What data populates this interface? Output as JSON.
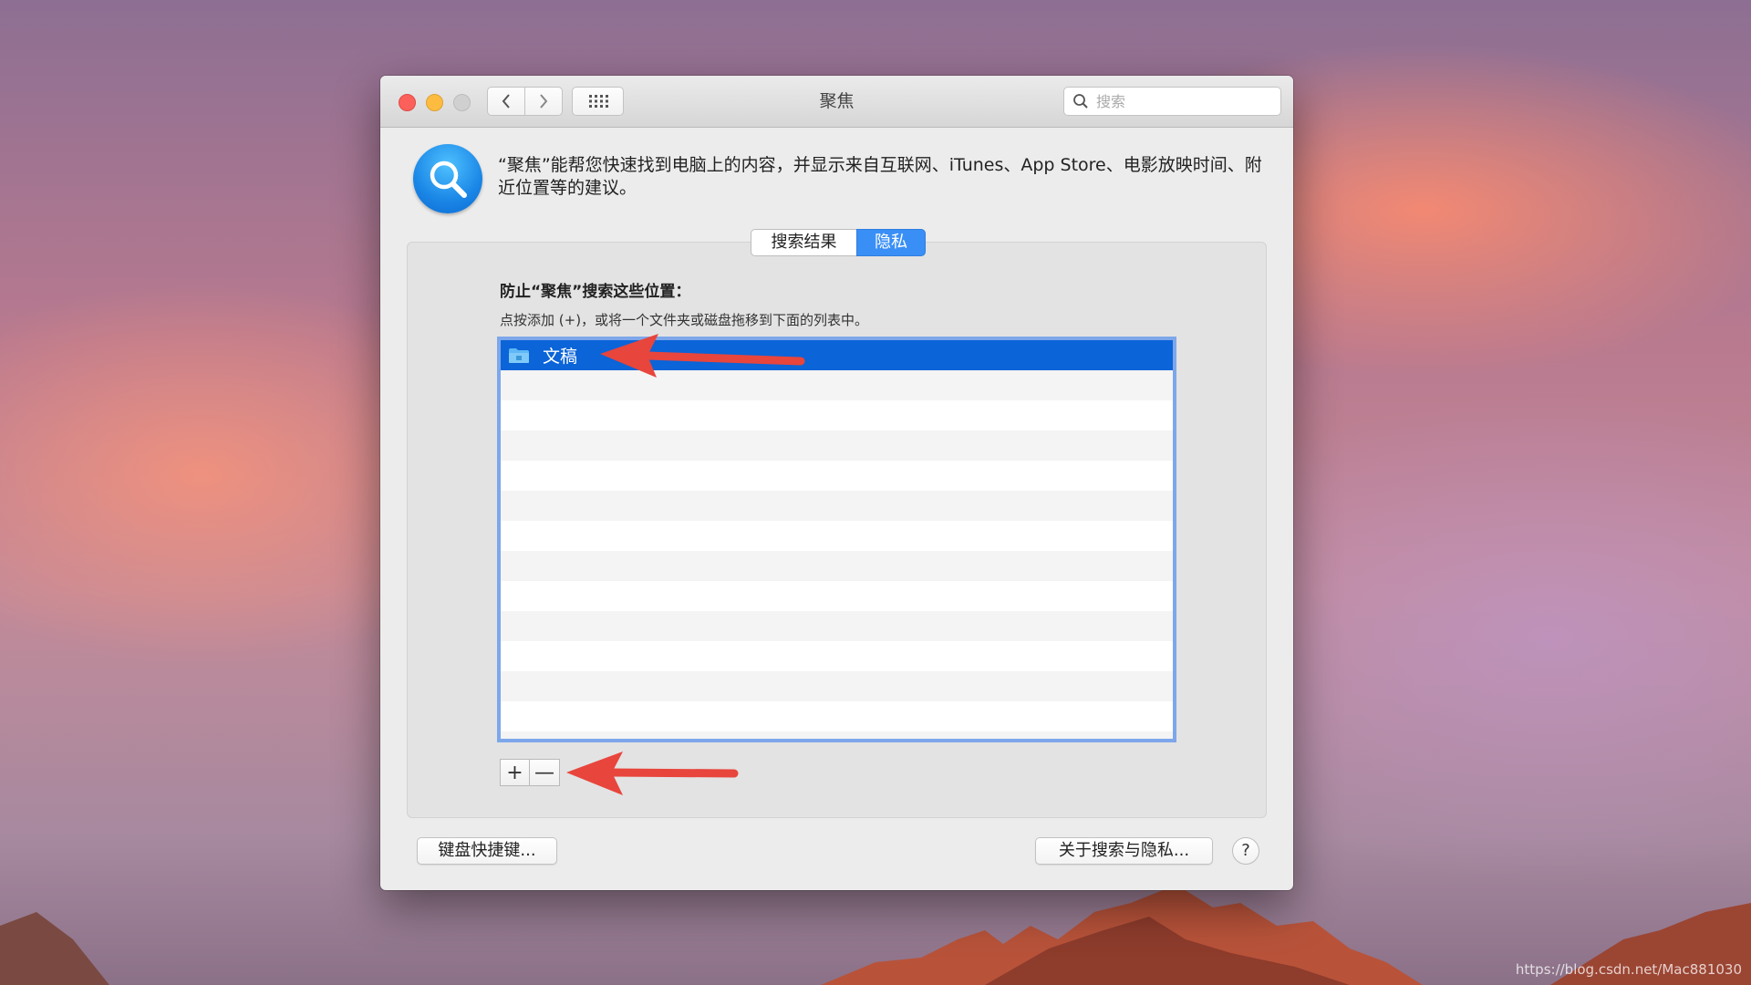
{
  "window": {
    "title": "聚焦",
    "search_placeholder": "搜索"
  },
  "header": {
    "description": "“聚焦”能帮您快速找到电脑上的内容，并显示来自互联网、iTunes、App Store、电影放映时间、附近位置等的建议。"
  },
  "tabs": [
    {
      "label": "搜索结果",
      "selected": false
    },
    {
      "label": "隐私",
      "selected": true
    }
  ],
  "privacy": {
    "heading": "防止“聚焦”搜索这些位置：",
    "hint": "点按添加 (+)，或将一个文件夹或磁盘拖移到下面的列表中。",
    "items": [
      {
        "label": "文稿",
        "icon": "folder-icon",
        "selected": true
      }
    ],
    "add_label": "+",
    "remove_label": "—"
  },
  "footer": {
    "shortcuts_label": "键盘快捷键...",
    "about_label": "关于搜索与隐私...",
    "help_label": "?"
  },
  "watermark": "https://blog.csdn.net/Mac881030",
  "colors": {
    "accent": "#0b64d8",
    "tab_selected": "#3a8ff6",
    "annotation_arrow": "#e8453c"
  }
}
